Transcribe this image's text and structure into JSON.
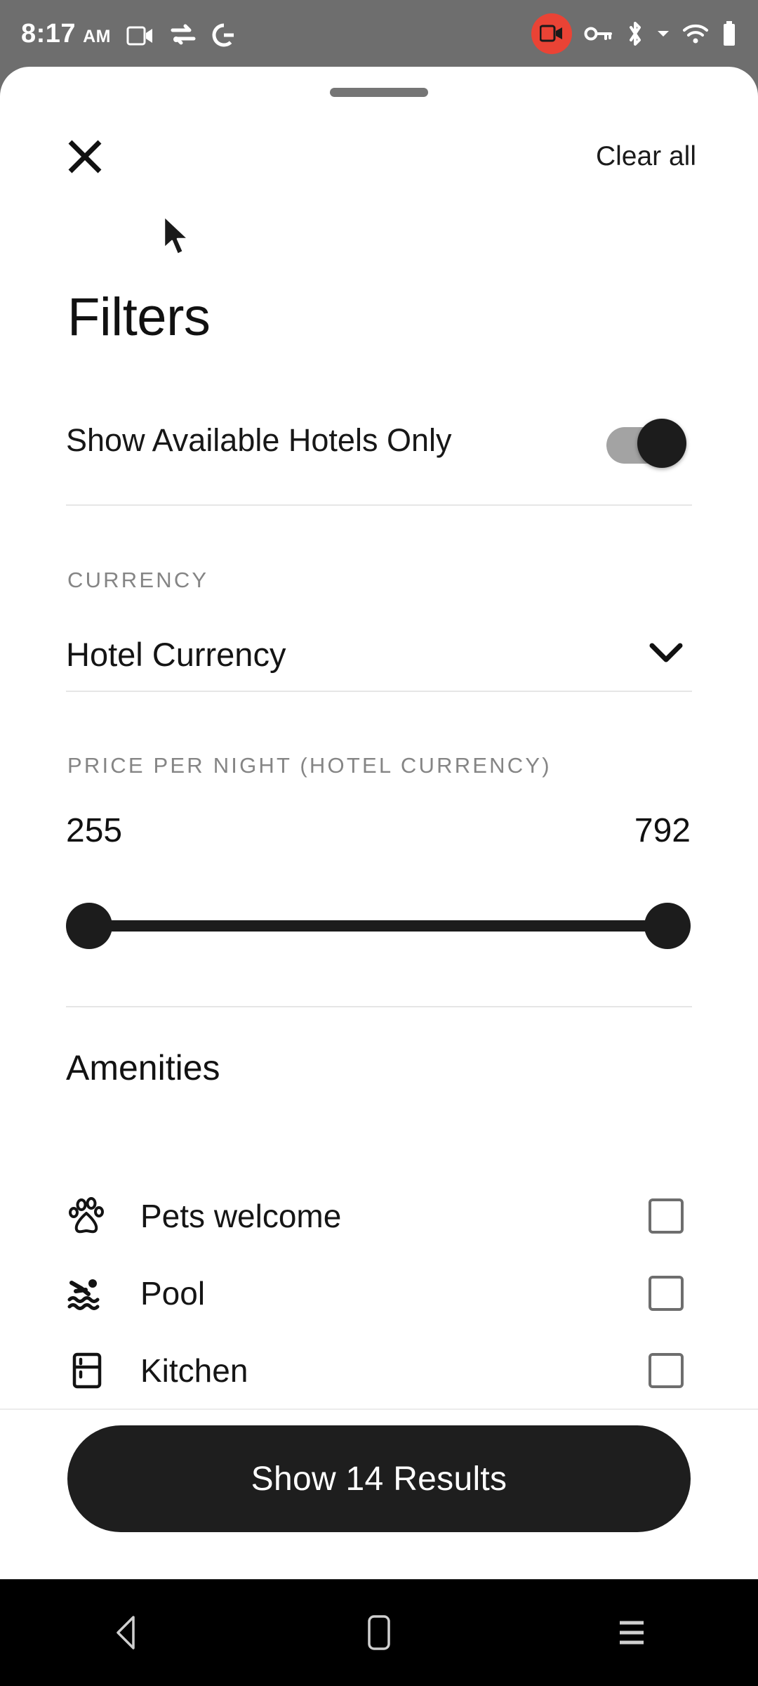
{
  "status_bar": {
    "time": "8:17",
    "ampm": "AM",
    "icons": [
      "video-camera-icon",
      "vpn-key-swap-icon",
      "google-g-icon"
    ],
    "right_icons": [
      "screen-record-active-icon",
      "vpn-key-icon",
      "bluetooth-icon",
      "dropdown-caret-icon",
      "wifi-icon",
      "battery-icon"
    ],
    "recording_badge_color": "#ea4335"
  },
  "sheet": {
    "close_label": "Close",
    "clear_all_label": "Clear all",
    "title": "Filters"
  },
  "availability": {
    "label": "Show Available Hotels Only",
    "enabled": true
  },
  "currency": {
    "section_label": "CURRENCY",
    "value": "Hotel Currency"
  },
  "price": {
    "section_label": "PRICE PER NIGHT (HOTEL CURRENCY)",
    "min": "255",
    "max": "792"
  },
  "amenities": {
    "title": "Amenities",
    "items": [
      {
        "label": "Pets welcome",
        "icon": "paw-icon",
        "checked": false
      },
      {
        "label": "Pool",
        "icon": "pool-swimmer-icon",
        "checked": false
      },
      {
        "label": "Kitchen",
        "icon": "kitchen-fridge-icon",
        "checked": false
      }
    ]
  },
  "footer": {
    "cta_label": "Show 14 Results"
  },
  "nav_bar": {
    "back_label": "Back",
    "home_label": "Home",
    "recents_label": "Recents"
  },
  "colors": {
    "accent": "#1e1e1e",
    "status_bar_bg": "#6e6e6e",
    "muted_text": "#858585"
  }
}
